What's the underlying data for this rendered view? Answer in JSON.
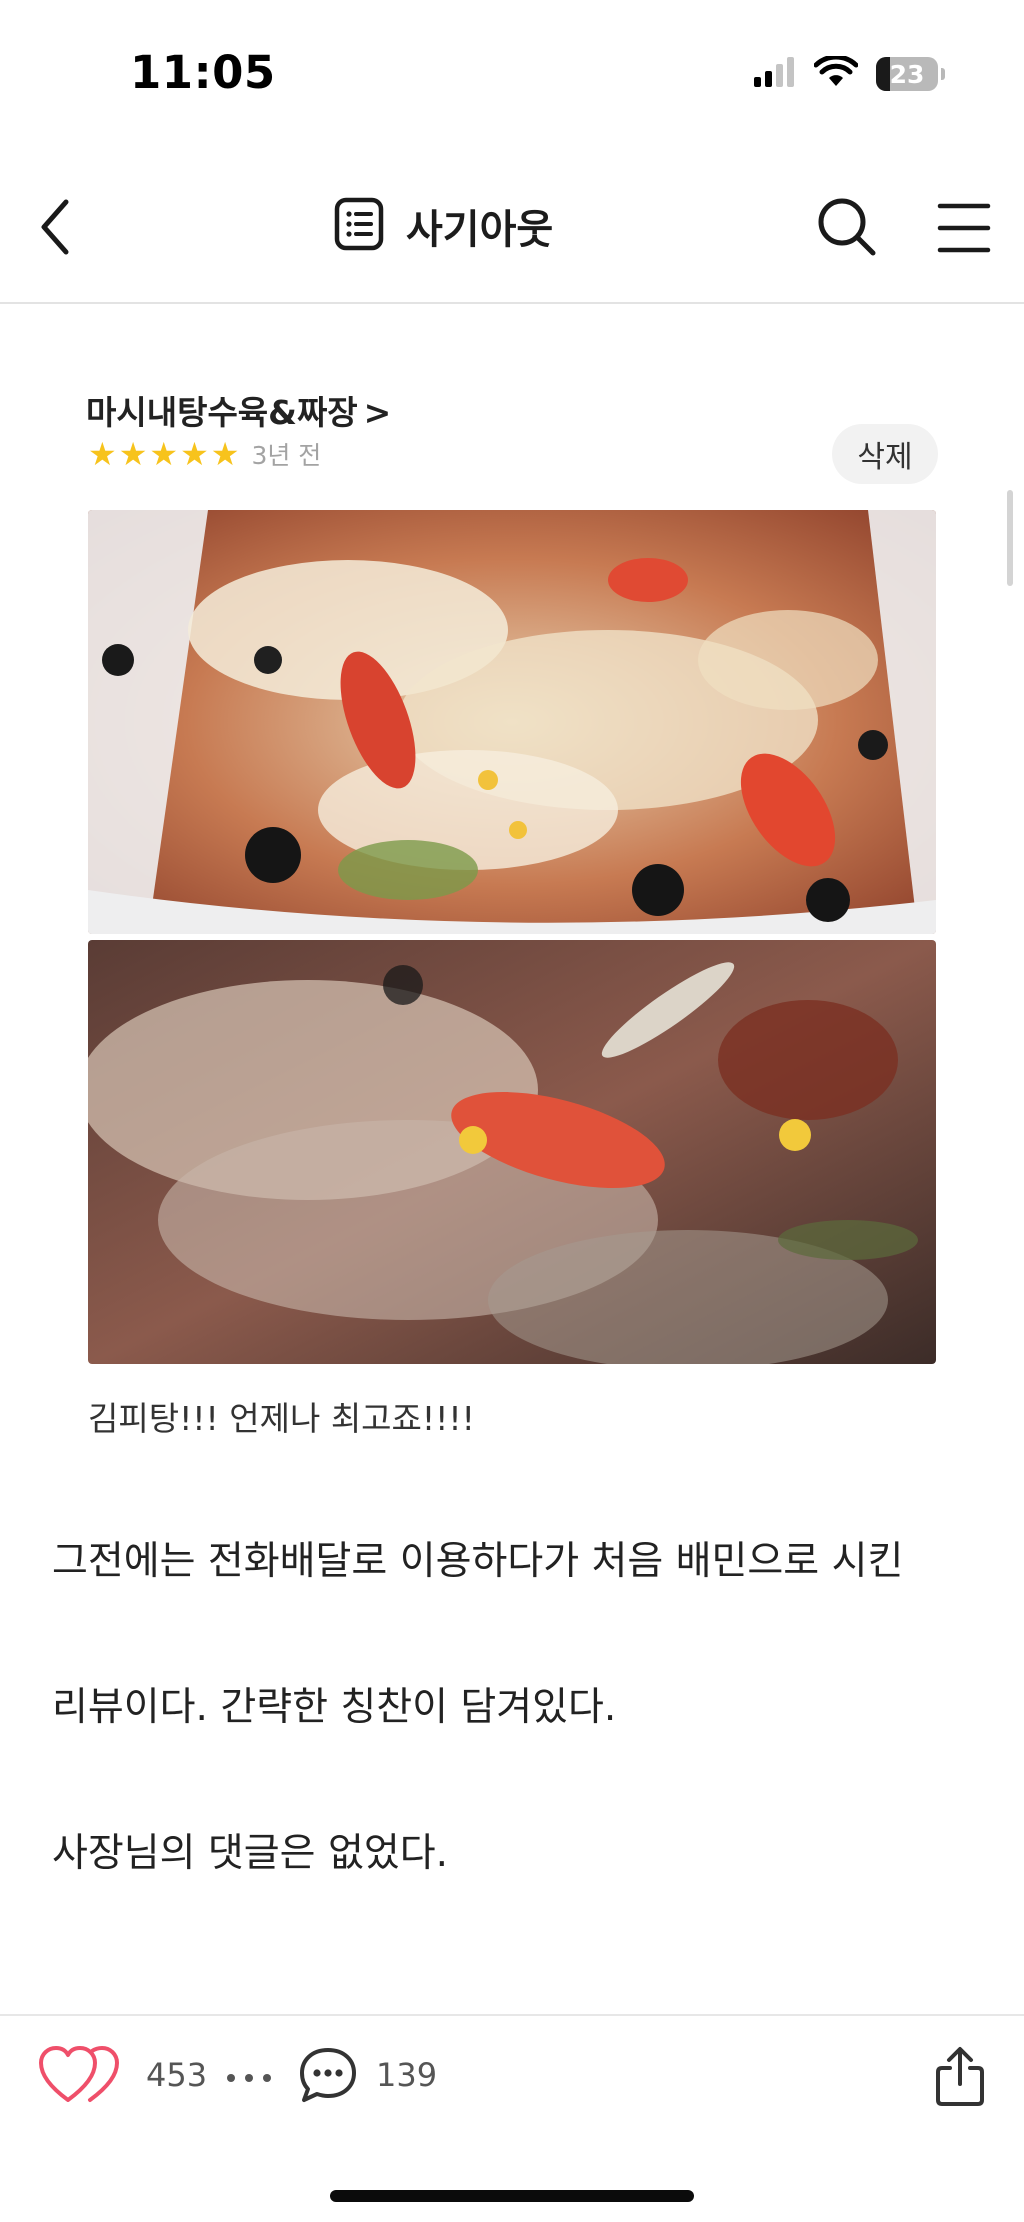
{
  "status_bar": {
    "time": "11:05",
    "battery_level": "23",
    "battery_fraction": 0.23,
    "cellular_bars_active": 2,
    "cellular_bars_total": 4
  },
  "header": {
    "title": "사기아웃",
    "back_icon": "chevron-left-icon",
    "title_icon": "list-document-icon",
    "search_icon": "search-icon",
    "menu_icon": "hamburger-menu-icon"
  },
  "review": {
    "store_name": "마시내탕수육&짜장",
    "store_chevron": ">",
    "stars": [
      "★",
      "★",
      "★",
      "★",
      "★"
    ],
    "rating": 5,
    "age": "3년 전",
    "delete_label": "삭제",
    "text": "김피탕!!! 언제나 최고죠!!!!",
    "photos": [
      "food-photo-pizza-topped-tangsuyuk",
      "food-photo-cheese-closeup"
    ]
  },
  "article": {
    "paragraphs": [
      "그전에는 전화배달로 이용하다가 처음 배민으로 시킨",
      "리뷰이다. 간략한 칭찬이 담겨있다.",
      "사장님의 댓글은 없었다."
    ]
  },
  "actions": {
    "like_count": "453",
    "comment_count": "139",
    "like_icon": "heart-icon",
    "more_icon": "more-dots-icon",
    "comment_icon": "comment-bubble-icon",
    "share_icon": "share-icon"
  },
  "colors": {
    "star": "#f7c31c",
    "like_heart": "#ef4f6a",
    "divider": "#e3e3e3",
    "delete_bg": "#f2f2f2"
  }
}
